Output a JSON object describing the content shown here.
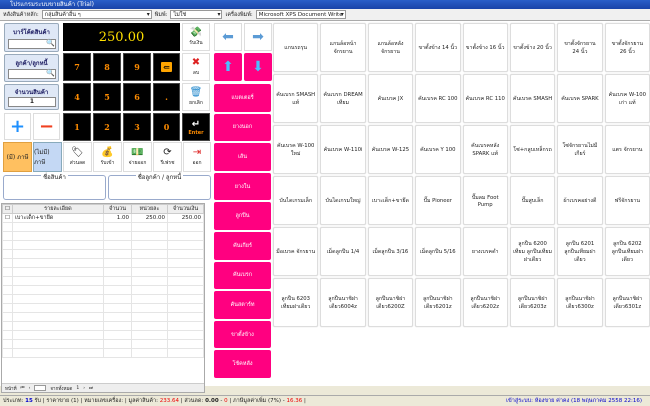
{
  "window": {
    "title": "โปรแกรมระบบขายสินค้า (Trial)"
  },
  "toolbar": {
    "group_label": "หลังสินค้าหลัก:",
    "group_value": "กลุ่มสินค้าอื่น ๆ",
    "print_label": "พิมพ์:",
    "print_value": "ไม่ใช่",
    "printer_label": "เครื่องพิมพ์:",
    "printer_value": "Microsoft XPS Document Write"
  },
  "left": {
    "barcode_label": "บาร์โค้ดสินค้า",
    "customer_label": "ลูกค้า/ลูกหนี้",
    "qty_label": "จำนวนสินค้า",
    "qty_value": "1",
    "tax_on": "(มี) ภาษี",
    "tax_off": "(ไม่มี) ภาษี",
    "product_name_label": "ชื่อสินค้า",
    "customer_name_label": "ชื่อลูกค้า / ลูกหนี้"
  },
  "display": {
    "amount": "250.00"
  },
  "keypad": {
    "row1": [
      "7",
      "8",
      "9"
    ],
    "row2": [
      "4",
      "5",
      "6",
      "."
    ],
    "row3": [
      "1",
      "2",
      "3",
      "0"
    ]
  },
  "actions": {
    "receive": "รับเงิน",
    "delete": "ลบ",
    "cancel": "ยกเลิก",
    "enter": "Enter",
    "discount": "ส่วนลด",
    "receive_in": "รับเข้า",
    "pay_out": "จ่ายออก",
    "refresh": "รีเฟรช",
    "exit": "ออก"
  },
  "categories": [
    "แบตเตอรี่",
    "ยางนอก",
    "เส้น",
    "ยางใน",
    "ลูกปืน",
    "คันเกียร์",
    "คันเบรก",
    "คันสตาร์ท",
    "ขาตั้งข้าง",
    "โช้คหลัง"
  ],
  "products": [
    "แกนรถรุน",
    "แกนล้อหน้า จักรยาน",
    "แกนล้อหลัง จักรยาน",
    "ขาตั้งข้าง 14 นิ้ว",
    "ขาตั้งข้าง 16 นิ้ว",
    "ขาตั้งข้าง 20 นิ้ว",
    "ขาตั้งจักรยาน 24 นิ้ว",
    "ขาตั้งจักรยาน 26 นิ้ว",
    "คันเบรก SMASH แท้",
    "คันเบรก DREAM เทียม",
    "คันเบรค JX",
    "คันเบรค RC 100",
    "คันเบรค RC 110",
    "คันเบรค SMASH",
    "คันเบรค SPARK",
    "คันเบรค W-100 เก่า แท้",
    "คันเบรค W-100 ใหม่",
    "คันเบรค W-110i",
    "คันเบรค W-125",
    "คันเบรค Y 100",
    "คันเบรคหลัง SPARK แท้",
    "โซ่+กลูบเหล็กรถ",
    "โซ่จักรยานไม่มีเกียร์",
    "แตร จักรยาน",
    "บันไดเกรมเล็ก",
    "บันไดเกรมใหญ่",
    "เบาะเด็ก+ขายึด",
    "ปั๊ม Pioneer",
    "ปั๊มลม Foot Pump",
    "ปั๊มสูบเล็ก",
    "ผ้าเบรคอย่างดี",
    "ฟรีจักรยาน",
    "มือเบรค จักรยาน",
    "เม็ดลูกปืน 1/4",
    "เม็ดลูกปืน 3/16",
    "เม็ดลูกปืน 5/16",
    "ยางเบรคดำ",
    "ลูกปืน 6200 เทียม ลูกปืนเทียมฝาเดียว",
    "ลูกปืน 6201 ลูกปืนเทียมฝาเดียว",
    "ลูกปืน 6202 ลูกปืนเทียมฝาเดียว",
    "ลูกปืน 6203 เทียมฝาเดียว",
    "ลูกปืนนาชิฝาเดียว6004z",
    "ลูกปืนนาชิฝาเดียว6200Z",
    "ลูกปืนนาชิฝาเดียว6201z",
    "ลูกปืนนาชิฝาเดียว6202z",
    "ลูกปืนนาชิฝาเดียว6203z",
    "ลูกปืนนาชิฝาเดียว6300z",
    "ลูกปืนนาชิฝาเดียว6301z"
  ],
  "table": {
    "headers": [
      "รายละเอียด",
      "จำนวน",
      "หน่วยละ",
      "จำนวนเงิน"
    ],
    "rows": [
      {
        "name": "เบาะเด็ก+ขายึด",
        "qty": "1.00",
        "price": "250.00",
        "amount": "250.00"
      }
    ]
  },
  "pager": {
    "prefix": "หน้าที่",
    "of": "จากทั้งหมด",
    "total": "1"
  },
  "status": {
    "items_label": "ประเภท:",
    "items": "15",
    "items_unit": "รับ",
    "price_label": "ราคาขาย (1)",
    "device_label": "หมายเลขเครื่อง:",
    "value_label": "มูลค่าสินค้า:",
    "value": "233.64",
    "discount_label": "ส่วนลด:",
    "discount": "0.00",
    "discount2": "0",
    "vat_label": "ภาษีมูลค่าเพิ่ม (7%)",
    "vat": "16.36",
    "user": "เข้าสู่ระบบ: ห้องขาย ค่าคง (18 พฤษภาคม 2558 22:16)"
  }
}
